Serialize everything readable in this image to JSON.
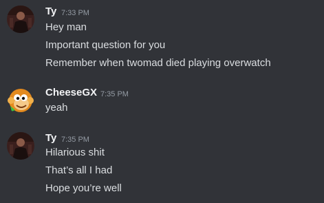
{
  "messages": [
    {
      "username": "Ty",
      "timestamp": "7:33 PM",
      "avatar_icon": "dark-figure-avatar-icon",
      "lines": [
        "Hey man",
        "Important question for you",
        "Remember when twomad died playing overwatch"
      ]
    },
    {
      "username": "CheeseGX",
      "timestamp": "7:35 PM",
      "avatar_icon": "cartoon-monkey-avatar-icon",
      "lines": [
        "yeah"
      ]
    },
    {
      "username": "Ty",
      "timestamp": "7:35 PM",
      "avatar_icon": "dark-figure-avatar-icon",
      "lines": [
        "Hilarious shit",
        "That’s all I had",
        "Hope you’re well"
      ]
    }
  ],
  "colors": {
    "background": "#313338",
    "username": "#f2f3f5",
    "timestamp": "#949ba4",
    "message_text": "#dbdee1"
  }
}
